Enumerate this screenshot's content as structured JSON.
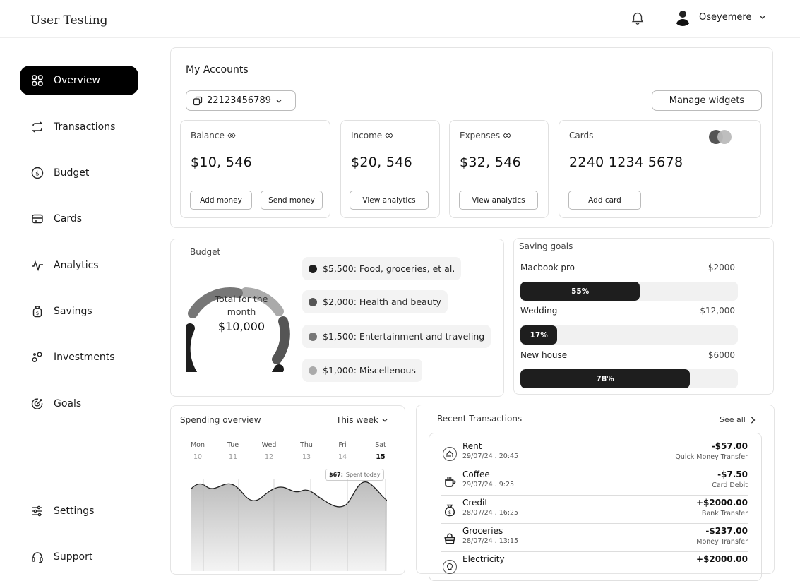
{
  "app": {
    "title": "User Testing"
  },
  "user": {
    "name": "Oseyemere"
  },
  "sidebar": {
    "items": [
      {
        "label": "Overview",
        "icon": "grid-icon"
      },
      {
        "label": "Transactions",
        "icon": "swap-icon"
      },
      {
        "label": "Budget",
        "icon": "dollar-circle-icon"
      },
      {
        "label": "Cards",
        "icon": "card-icon"
      },
      {
        "label": "Analytics",
        "icon": "pulse-icon"
      },
      {
        "label": "Savings",
        "icon": "money-bag-icon"
      },
      {
        "label": "Investments",
        "icon": "circles-icon"
      },
      {
        "label": "Goals",
        "icon": "target-icon"
      }
    ],
    "bottom": [
      {
        "label": "Settings",
        "icon": "sliders-icon"
      },
      {
        "label": "Support",
        "icon": "headset-icon"
      }
    ]
  },
  "accounts": {
    "title": "My Accounts",
    "account_number": "22123456789",
    "manage_label": "Manage widgets",
    "balance": {
      "label": "Balance",
      "value": "$10, 546",
      "btn1": "Add money",
      "btn2": "Send money"
    },
    "income": {
      "label": "Income",
      "value": "$20, 546",
      "btn": "View analytics"
    },
    "expenses": {
      "label": "Expenses",
      "value": "$32, 546",
      "btn": "View analytics"
    },
    "cards": {
      "label": "Cards",
      "value": "2240 1234 5678",
      "btn": "Add card"
    }
  },
  "budget": {
    "title": "Budget",
    "center_label": "Total for the month",
    "center_total": "$10,000",
    "items": [
      {
        "label": "$5,500: Food, groceries, et al.",
        "color": "#1e1e1e"
      },
      {
        "label": "$2,000: Health and beauty",
        "color": "#555555"
      },
      {
        "label": "$1,500: Entertainment and traveling",
        "color": "#777777"
      },
      {
        "label": "$1,000: Miscellenous",
        "color": "#aaaaaa"
      }
    ]
  },
  "saving_goals": {
    "title": "Saving goals",
    "goals": [
      {
        "name": "Macbook pro",
        "amount": "$2000",
        "percent": 55,
        "percent_label": "55%"
      },
      {
        "name": "Wedding",
        "amount": "$12,000",
        "percent": 17,
        "percent_label": "17%"
      },
      {
        "name": "New house",
        "amount": "$6000",
        "percent": 78,
        "percent_label": "78%"
      }
    ]
  },
  "spending": {
    "title": "Spending overview",
    "period": "This week",
    "days": [
      {
        "name": "Mon",
        "num": "10"
      },
      {
        "name": "Tue",
        "num": "11"
      },
      {
        "name": "Wed",
        "num": "12"
      },
      {
        "name": "Thu",
        "num": "13"
      },
      {
        "name": "Fri",
        "num": "14"
      },
      {
        "name": "Sat",
        "num": "15"
      }
    ],
    "tooltip_value": "$67:",
    "tooltip_label": "Spent today"
  },
  "recent": {
    "title": "Recent Transactions",
    "see_all": "See all",
    "rows": [
      {
        "name": "Rent",
        "date": "29/07/24 . 20:45",
        "amount": "-$57.00",
        "type": "Quick Money Transfer",
        "icon": "home-icon"
      },
      {
        "name": "Coffee",
        "date": "29/07/24 . 9:25",
        "amount": "-$7.50",
        "type": "Card Debit",
        "icon": "coffee-icon"
      },
      {
        "name": "Credit",
        "date": "28/07/24 . 16:25",
        "amount": "+$2000.00",
        "type": "Bank Transfer",
        "icon": "money-bag-icon"
      },
      {
        "name": "Groceries",
        "date": "28/07/24 . 13:15",
        "amount": "-$237.00",
        "type": "Money Transfer",
        "icon": "basket-icon"
      },
      {
        "name": "Electricity",
        "date": "",
        "amount": "+$2000.00",
        "type": "",
        "icon": "bulb-icon"
      }
    ]
  },
  "colors": {
    "accent": "#000000",
    "bar": "#1e1e1e",
    "track": "#f1f1f1"
  }
}
